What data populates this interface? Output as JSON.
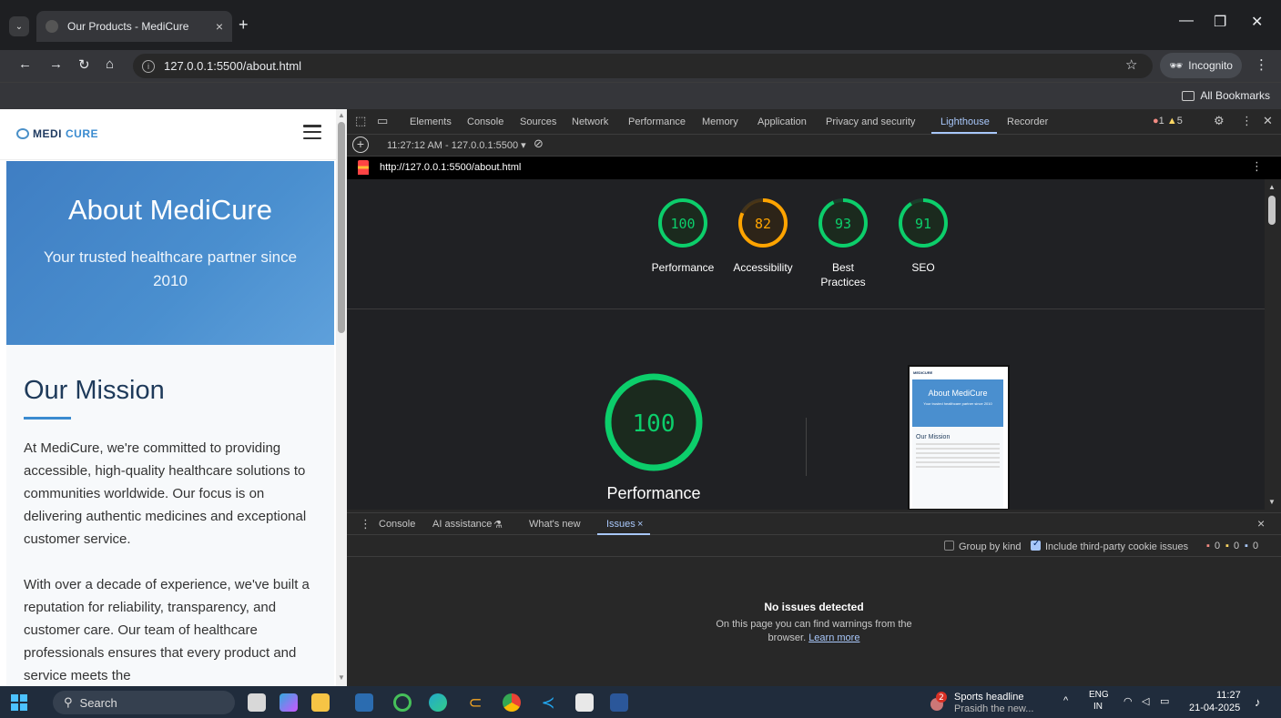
{
  "browser": {
    "tab_title": "Our Products - MediCure",
    "tab_close": "×",
    "new_tab": "+",
    "url": "127.0.0.1:5500/about.html",
    "incognito_label": "Incognito",
    "bookmarks_label": "All Bookmarks"
  },
  "page": {
    "logo_brand_a": "MEDI",
    "logo_brand_b": "CURE",
    "hero_title": "About MediCure",
    "hero_subtitle": "Your trusted healthcare partner since 2010",
    "mission_title": "Our Mission",
    "mission_p1": "At MediCure, we're committed to providing accessible, high-quality healthcare solutions to communities worldwide. Our focus is on delivering authentic medicines and exceptional customer service.",
    "mission_p2": "With over a decade of experience, we've built a reputation for reliability, transparency, and customer care. Our team of healthcare professionals ensures that every product and service meets the"
  },
  "devtools": {
    "tabs": [
      "Elements",
      "Console",
      "Sources",
      "Network",
      "Performance",
      "Memory",
      "Application",
      "Privacy and security",
      "Lighthouse",
      "Recorder"
    ],
    "error_count": "1",
    "warning_count": "5",
    "report_selector": "11:27:12 AM - 127.0.0.1:5500 ▾",
    "report_url": "http://127.0.0.1:5500/about.html",
    "scores": [
      {
        "label": "Performance",
        "value": "100",
        "fraction": 1.0,
        "color": "#0cce6b"
      },
      {
        "label": "Accessibility",
        "value": "82",
        "fraction": 0.82,
        "color": "#ffa400"
      },
      {
        "label": "Best Practices",
        "value": "93",
        "fraction": 0.93,
        "color": "#0cce6b"
      },
      {
        "label": "SEO",
        "value": "91",
        "fraction": 0.91,
        "color": "#0cce6b"
      }
    ],
    "big_score": {
      "label": "Performance",
      "value": "100",
      "fraction": 1.0
    },
    "thumb": {
      "brand": "MEDICURE",
      "hero_title": "About MediCure",
      "hero_sub": "Your trusted healthcare partner since 2010",
      "mission": "Our Mission"
    },
    "drawer_tabs": [
      "Console",
      "AI assistance",
      "What's new",
      "Issues"
    ],
    "ai_beta_glyph": "⚗",
    "issues_close": "×",
    "drawer_close": "×",
    "group_by_kind": "Group by kind",
    "include_third_party": "Include third-party cookie issues",
    "issue_counts": [
      "0",
      "0",
      "0"
    ],
    "no_issues_title": "No issues detected",
    "no_issues_text": "On this page you can find warnings from the browser.",
    "learn_more": "Learn more"
  },
  "taskbar": {
    "search_label": "Search",
    "news_badge": "2",
    "news_title": "Sports headline",
    "news_sub": "Prasidh the new...",
    "lang_top": "ENG",
    "lang_bottom": "IN",
    "time": "11:27",
    "date": "21-04-2025"
  },
  "colors": {
    "accent": "#a8c7fa",
    "pass": "#0cce6b",
    "average": "#ffa400",
    "hero_blue": "#4a8fcf"
  }
}
